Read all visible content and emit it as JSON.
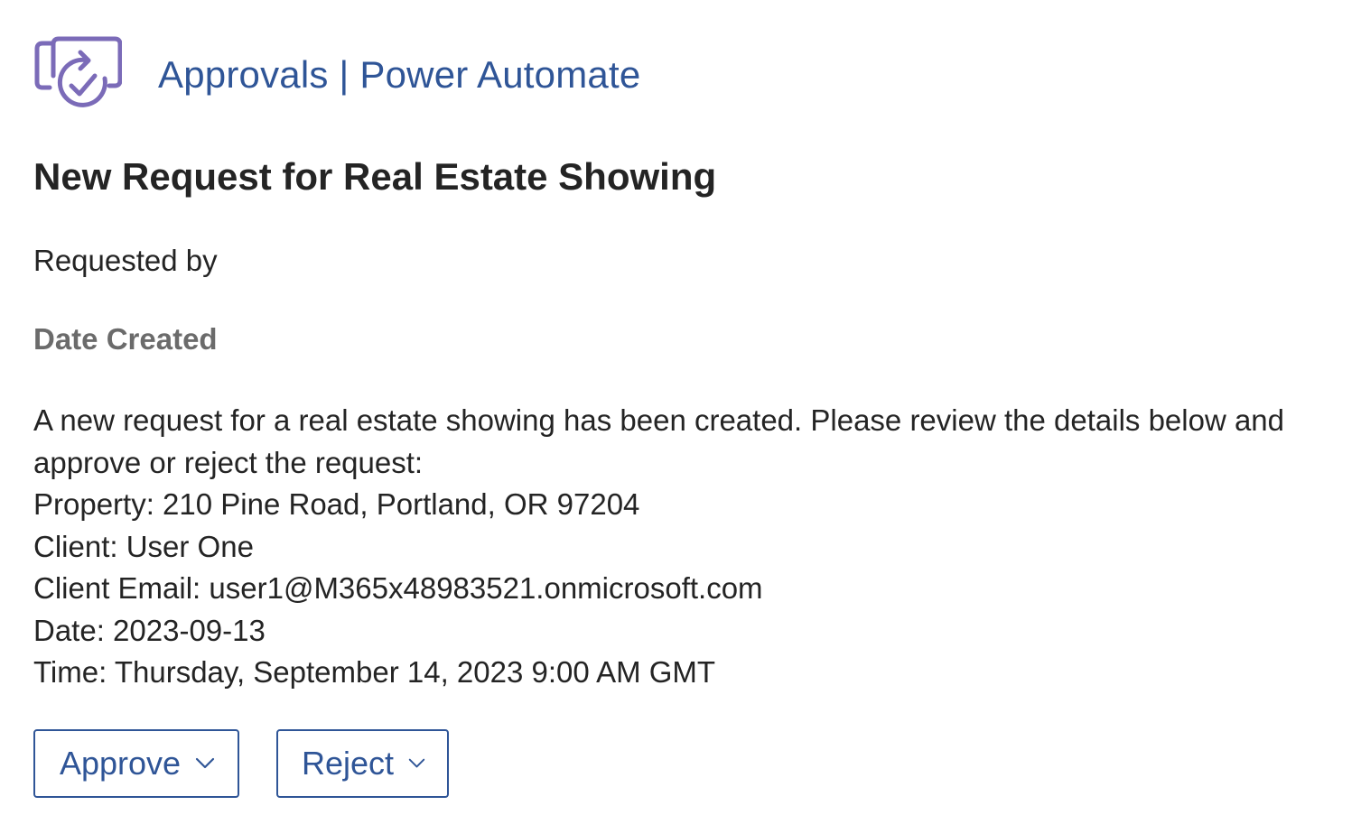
{
  "header": {
    "app_icon": "approvals-icon",
    "title": "Approvals | Power Automate",
    "brand_color": "#2f5597",
    "icon_color": "#7b6bb8"
  },
  "card": {
    "title": "New Request for Real Estate Showing",
    "requested_by_label": "Requested by",
    "date_created_label": "Date Created",
    "body_lines": [
      "A new request for a real estate showing has been created. Please review the details below and",
      "approve or reject the request:",
      "Property: 210 Pine Road, Portland, OR 97204",
      "Client: User One",
      "Client Email: user1@M365x48983521.onmicrosoft.com",
      "Date: 2023-09-13",
      "Time: Thursday, September 14, 2023 9:00 AM GMT"
    ]
  },
  "actions": {
    "approve_label": "Approve",
    "reject_label": "Reject",
    "dropdown_icon": "chevron-down-icon"
  }
}
